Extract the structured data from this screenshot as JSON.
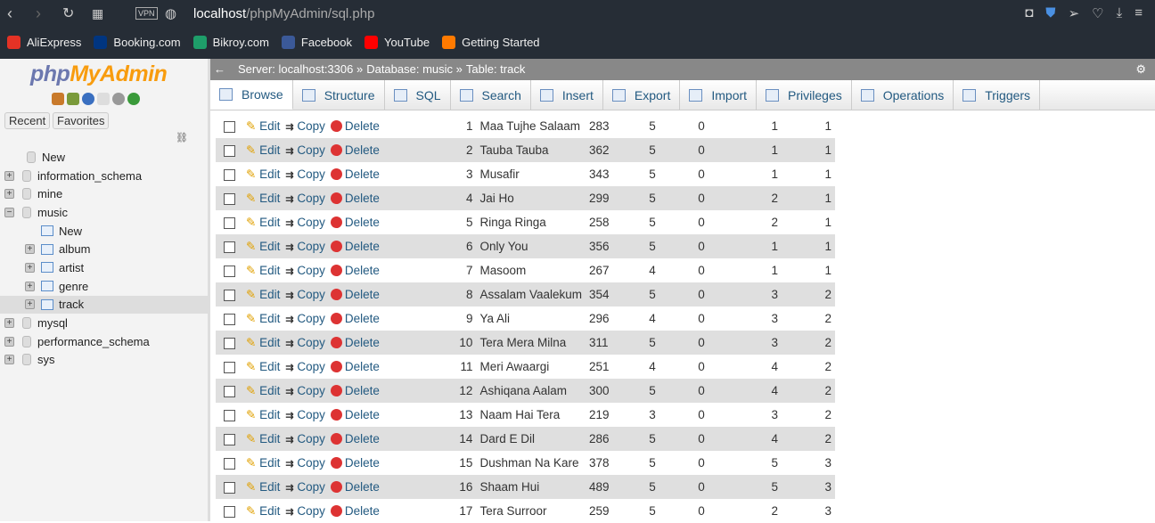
{
  "browser": {
    "url_host": "localhost",
    "url_path": "/phpMyAdmin/sql.php",
    "vpn": "VPN",
    "bookmarks": [
      {
        "label": "AliExpress",
        "color": "#e43225"
      },
      {
        "label": "Booking.com",
        "color": "#003580"
      },
      {
        "label": "Bikroy.com",
        "color": "#1e9e6a"
      },
      {
        "label": "Facebook",
        "color": "#3b5998"
      },
      {
        "label": "YouTube",
        "color": "#ff0000"
      },
      {
        "label": "Getting Started",
        "color": "#ff7a00"
      }
    ]
  },
  "sidebar": {
    "logo_php": "php",
    "logo_my": "MyAdmin",
    "recent": "Recent",
    "favorites": "Favorites",
    "tree": [
      {
        "label": "New",
        "level": 0,
        "type": "new"
      },
      {
        "label": "information_schema",
        "level": 0,
        "type": "db",
        "toggle": "+"
      },
      {
        "label": "mine",
        "level": 0,
        "type": "db",
        "toggle": "+"
      },
      {
        "label": "music",
        "level": 0,
        "type": "db",
        "toggle": "−"
      },
      {
        "label": "New",
        "level": 1,
        "type": "new"
      },
      {
        "label": "album",
        "level": 1,
        "type": "table",
        "toggle": "+"
      },
      {
        "label": "artist",
        "level": 1,
        "type": "table",
        "toggle": "+"
      },
      {
        "label": "genre",
        "level": 1,
        "type": "table",
        "toggle": "+"
      },
      {
        "label": "track",
        "level": 1,
        "type": "table",
        "toggle": "+",
        "selected": true
      },
      {
        "label": "mysql",
        "level": 0,
        "type": "db",
        "toggle": "+"
      },
      {
        "label": "performance_schema",
        "level": 0,
        "type": "db",
        "toggle": "+"
      },
      {
        "label": "sys",
        "level": 0,
        "type": "db",
        "toggle": "+"
      }
    ]
  },
  "breadcrumb": {
    "server": "Server: localhost:3306 »",
    "database": "Database: music »",
    "table": "Table: track"
  },
  "tabs": [
    "Browse",
    "Structure",
    "SQL",
    "Search",
    "Insert",
    "Export",
    "Import",
    "Privileges",
    "Operations",
    "Triggers"
  ],
  "actions": {
    "edit": "Edit",
    "copy": "Copy",
    "delete": "Delete"
  },
  "rows": [
    [
      "1",
      "Maa Tujhe Salaam",
      "283",
      "5",
      "0",
      "1",
      "1"
    ],
    [
      "2",
      "Tauba Tauba",
      "362",
      "5",
      "0",
      "1",
      "1"
    ],
    [
      "3",
      "Musafir",
      "343",
      "5",
      "0",
      "1",
      "1"
    ],
    [
      "4",
      "Jai Ho",
      "299",
      "5",
      "0",
      "2",
      "1"
    ],
    [
      "5",
      "Ringa Ringa",
      "258",
      "5",
      "0",
      "2",
      "1"
    ],
    [
      "6",
      "Only You",
      "356",
      "5",
      "0",
      "1",
      "1"
    ],
    [
      "7",
      "Masoom",
      "267",
      "4",
      "0",
      "1",
      "1"
    ],
    [
      "8",
      "Assalam Vaalekum",
      "354",
      "5",
      "0",
      "3",
      "2"
    ],
    [
      "9",
      "Ya Ali",
      "296",
      "4",
      "0",
      "3",
      "2"
    ],
    [
      "10",
      "Tera Mera Milna",
      "311",
      "5",
      "0",
      "3",
      "2"
    ],
    [
      "11",
      "Meri Awaargi",
      "251",
      "4",
      "0",
      "4",
      "2"
    ],
    [
      "12",
      "Ashiqana Aalam",
      "300",
      "5",
      "0",
      "4",
      "2"
    ],
    [
      "13",
      "Naam Hai Tera",
      "219",
      "3",
      "0",
      "3",
      "2"
    ],
    [
      "14",
      "Dard E Dil",
      "286",
      "5",
      "0",
      "4",
      "2"
    ],
    [
      "15",
      "Dushman Na Kare",
      "378",
      "5",
      "0",
      "5",
      "3"
    ],
    [
      "16",
      "Shaam Hui",
      "489",
      "5",
      "0",
      "5",
      "3"
    ],
    [
      "17",
      "Tera Surroor",
      "259",
      "5",
      "0",
      "2",
      "3"
    ]
  ]
}
